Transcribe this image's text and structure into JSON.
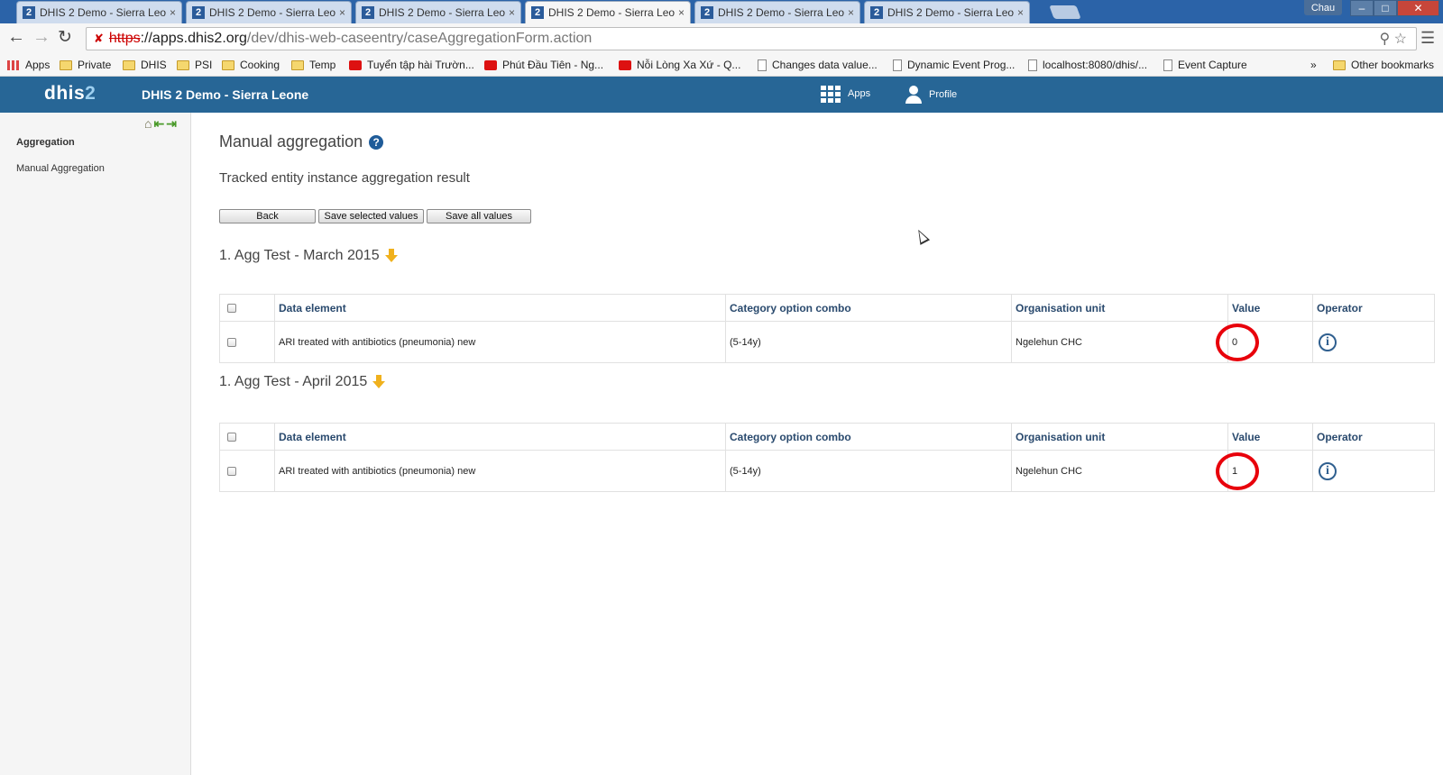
{
  "browser": {
    "tabs": [
      {
        "title": "DHIS 2 Demo - Sierra Leo",
        "active": false
      },
      {
        "title": "DHIS 2 Demo - Sierra Leo",
        "active": false
      },
      {
        "title": "DHIS 2 Demo - Sierra Leo",
        "active": false
      },
      {
        "title": "DHIS 2 Demo - Sierra Leo",
        "active": true
      },
      {
        "title": "DHIS 2 Demo - Sierra Leo",
        "active": false
      },
      {
        "title": "DHIS 2 Demo - Sierra Leo",
        "active": false
      }
    ],
    "tab_favicon": "2",
    "tab_close_glyph": "×",
    "window_user": "Chau",
    "url": {
      "scheme": "https",
      "host": "://apps.dhis2.org",
      "path": "/dev/dhis-web-caseentry/caseAggregationForm.action"
    },
    "bookmarks": [
      {
        "label": "Apps",
        "icon": "apps-grid-icon"
      },
      {
        "label": "Private",
        "icon": "folder-icon"
      },
      {
        "label": "DHIS",
        "icon": "folder-icon"
      },
      {
        "label": "PSI",
        "icon": "folder-icon"
      },
      {
        "label": "Cooking",
        "icon": "folder-icon"
      },
      {
        "label": "Temp",
        "icon": "folder-icon"
      },
      {
        "label": "Tuyển tập hài Trườn...",
        "icon": "youtube-icon"
      },
      {
        "label": "Phút Đầu Tiên - Ng...",
        "icon": "youtube-icon"
      },
      {
        "label": "Nỗi Lòng Xa Xứ - Q...",
        "icon": "youtube-icon"
      },
      {
        "label": "Changes data value...",
        "icon": "page-icon"
      },
      {
        "label": "Dynamic Event Prog...",
        "icon": "page-icon"
      },
      {
        "label": "localhost:8080/dhis/...",
        "icon": "page-icon"
      },
      {
        "label": "Event Capture",
        "icon": "page-icon"
      }
    ],
    "bookmarks_overflow": "»",
    "other_bookmarks": "Other bookmarks"
  },
  "header": {
    "logo_main": "dhis",
    "logo_num": "2",
    "title": "DHIS 2 Demo - Sierra Leone",
    "apps_label": "Apps",
    "profile_label": "Profile"
  },
  "sidebar": {
    "heading": "Aggregation",
    "link": "Manual Aggregation"
  },
  "main": {
    "title": "Manual aggregation",
    "help_glyph": "?",
    "subtitle": "Tracked entity instance aggregation result",
    "buttons": {
      "back": "Back",
      "save_selected": "Save selected values",
      "save_all": "Save all values"
    },
    "columns": {
      "data_element": "Data element",
      "category_option_combo": "Category option combo",
      "organisation_unit": "Organisation unit",
      "value": "Value",
      "operator": "Operator"
    },
    "info_glyph": "i",
    "sections": [
      {
        "title": "1. Agg Test - March 2015",
        "row": {
          "data_element": "ARI treated with antibiotics (pneumonia) new",
          "category_option_combo": "(5-14y)",
          "organisation_unit": "Ngelehun CHC",
          "value": "0"
        }
      },
      {
        "title": "1. Agg Test - April 2015",
        "row": {
          "data_element": "ARI treated with antibiotics (pneumonia) new",
          "category_option_combo": "(5-14y)",
          "organisation_unit": "Ngelehun CHC",
          "value": "1"
        }
      }
    ]
  },
  "colors": {
    "header_bg": "#276696",
    "highlight_ring": "#e8000b",
    "section_arrow": "#f0b11d"
  }
}
